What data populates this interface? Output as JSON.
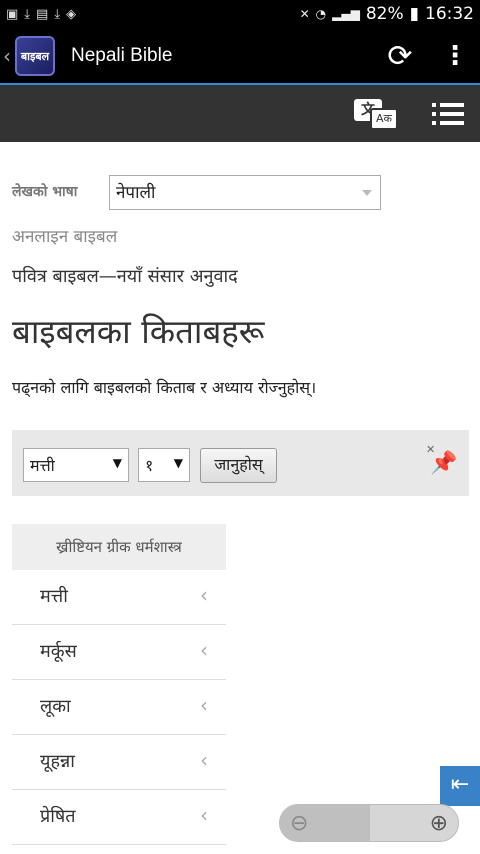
{
  "status_bar": {
    "left_icons": [
      "gallery-icon",
      "download-icon",
      "image-icon",
      "download-icon",
      "shield-icon"
    ],
    "battery": "82%",
    "time": "16:32"
  },
  "app_bar": {
    "title": "Nepali Bible",
    "logo_text": "बाइबल"
  },
  "site_toolbar": {
    "lang_icon_left": "文",
    "lang_icon_right": "Aक"
  },
  "content": {
    "lang_label": "लेखको भाषा",
    "lang_value": "नेपाली",
    "online_bible": "अनलाइन बाइबल",
    "translation": "पवित्र बाइबल—नयाँ संसार अनुवाद",
    "page_title": "बाइबलका किताबहरू",
    "instructions": "पढ्नको लागि बाइबलको किताब र अध्याय रोज्नुहोस्।"
  },
  "nav": {
    "book_value": "मत्ती",
    "chapter_value": "१",
    "go_label": "जानुहोस्"
  },
  "books": {
    "section_title": "ख्रीष्टियन ग्रीक धर्मशास्त्र",
    "items": [
      {
        "label": "मत्ती"
      },
      {
        "label": "मर्कूस"
      },
      {
        "label": "लूका"
      },
      {
        "label": "यूहन्ना"
      },
      {
        "label": "प्रेषित"
      }
    ]
  },
  "colors": {
    "accent": "#2a8fd6",
    "toolbar": "#333333",
    "collapse_button": "#3a82c8"
  }
}
